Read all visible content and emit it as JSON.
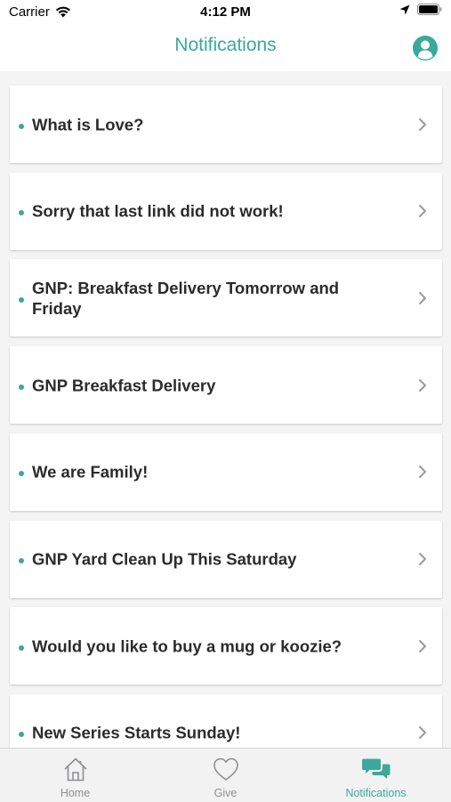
{
  "status_bar": {
    "carrier": "Carrier",
    "time": "4:12 PM"
  },
  "header": {
    "title": "Notifications",
    "profile_icon": "user-circle-icon"
  },
  "colors": {
    "accent": "#3aa99a",
    "inactive": "#8e8e93",
    "text": "#2b2b2b"
  },
  "notifications": [
    {
      "title": "What is Love?"
    },
    {
      "title": "Sorry that last link did not work!"
    },
    {
      "title": "GNP: Breakfast Delivery Tomorrow and Friday"
    },
    {
      "title": "GNP Breakfast Delivery"
    },
    {
      "title": "We are Family!"
    },
    {
      "title": "GNP Yard Clean Up This Saturday"
    },
    {
      "title": "Would you like to buy a mug or koozie?"
    },
    {
      "title": "New Series Starts Sunday!"
    }
  ],
  "tabs": [
    {
      "label": "Home",
      "icon": "home-icon",
      "active": false
    },
    {
      "label": "Give",
      "icon": "heart-icon",
      "active": false
    },
    {
      "label": "Notifications",
      "icon": "chat-bubbles-icon",
      "active": true
    }
  ]
}
